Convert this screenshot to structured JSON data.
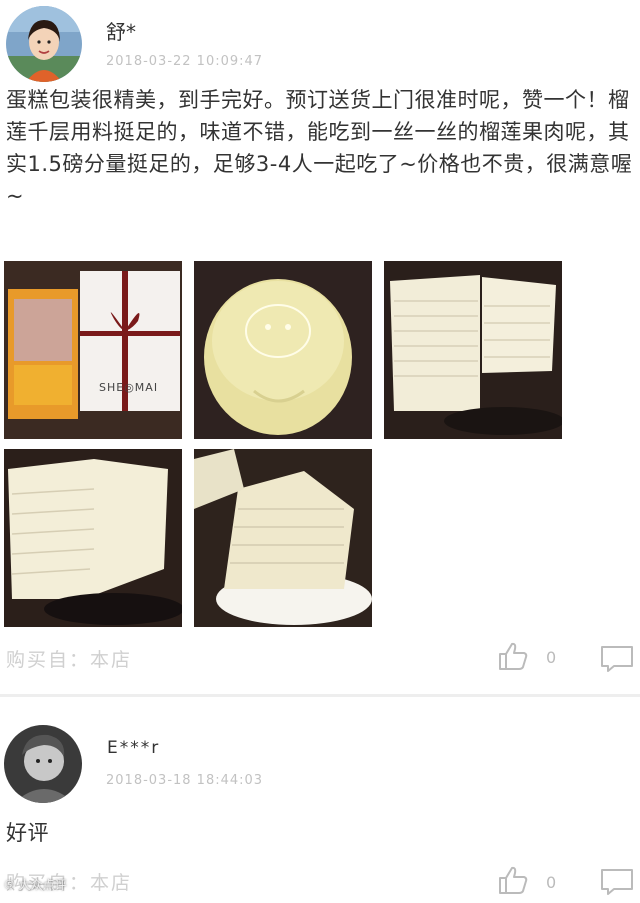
{
  "reviews": [
    {
      "username": "舒*",
      "timestamp": "2018-03-22  10:09:47",
      "text": "蛋糕包装很精美，到手完好。预订送货上门很准时呢，赞一个！榴莲千层用料挺足的，味道不错，能吃到一丝一丝的榴莲果肉呢，其实1.5磅分量挺足的，足够3-4人一起吃了~价格也不贵，很满意喔~",
      "photo_texts": {
        "box_brand": "SHE◎MAI"
      },
      "source_label": "购买自：本店",
      "like_count": "0",
      "icons": {
        "like": "thumbs-up-icon",
        "comment": "comment-bubble-icon"
      }
    },
    {
      "username": "E***r",
      "timestamp": "2018-03-18  18:44:03",
      "text": "好评",
      "source_label": "购买自：本店",
      "like_count": "0",
      "icons": {
        "like": "thumbs-up-icon",
        "comment": "comment-bubble-icon"
      }
    }
  ],
  "watermark": "⑤ 大众点评",
  "colors": {
    "icon_gray": "#bbbbbb",
    "meta_gray": "#c2c2c2"
  }
}
